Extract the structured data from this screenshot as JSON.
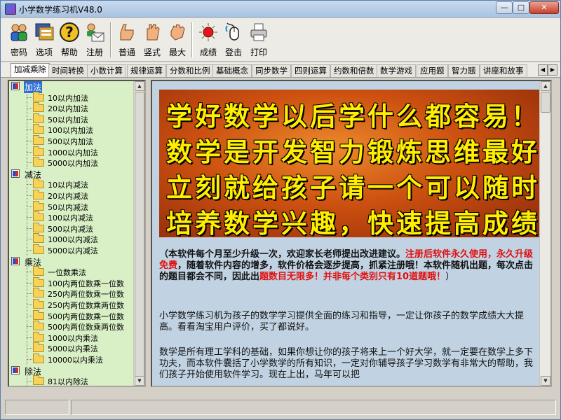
{
  "window": {
    "title": "小学数学练习机V48.0",
    "controls": {
      "minimize": "—",
      "maximize": "□",
      "close": "✕"
    }
  },
  "toolbar": {
    "buttons": [
      {
        "label": "密码",
        "icon": "users-icon"
      },
      {
        "label": "选项",
        "icon": "options-icon"
      },
      {
        "label": "帮助",
        "icon": "help-icon"
      },
      {
        "label": "注册",
        "icon": "register-icon"
      },
      {
        "label": "普通",
        "icon": "hand-normal-icon"
      },
      {
        "label": "竖式",
        "icon": "hand-vertical-icon"
      },
      {
        "label": "最大",
        "icon": "hand-max-icon"
      },
      {
        "label": "成绩",
        "icon": "score-icon"
      },
      {
        "label": "登击",
        "icon": "mouse-icon"
      },
      {
        "label": "打印",
        "icon": "printer-icon"
      }
    ]
  },
  "tabs": [
    "加减乘除",
    "时间转换",
    "小数计算",
    "规律运算",
    "分数和比例",
    "基础概念",
    "同步数学",
    "四则运算",
    "约数和倍数",
    "数学游戏",
    "应用题",
    "智力题",
    "讲座和故事"
  ],
  "tree": {
    "categories": [
      {
        "label": "加法",
        "selected": true,
        "items": [
          "10以内加法",
          "20以内加法",
          "50以内加法",
          "100以内加法",
          "500以内加法",
          "1000以内加法",
          "5000以内加法"
        ]
      },
      {
        "label": "减法",
        "selected": false,
        "items": [
          "10以内减法",
          "20以内减法",
          "50以内减法",
          "100以内减法",
          "500以内减法",
          "1000以内减法",
          "5000以内减法"
        ]
      },
      {
        "label": "乘法",
        "selected": false,
        "items": [
          "一位数乘法",
          "100内两位数乘一位数",
          "250内两位数乘一位数",
          "250内两位数乘两位数",
          "500内两位数乘一位数",
          "500内两位数乘两位数",
          "1000以内乘法",
          "5000以内乘法",
          "10000以内乘法"
        ]
      },
      {
        "label": "除法",
        "selected": false,
        "items": [
          "81以内除法"
        ]
      }
    ]
  },
  "content": {
    "banner_lines": [
      "学好数学以后学什么都容易！千万要",
      "数学是开发智力锻炼思维最好工具未",
      "立刻就给孩子请一个可以随时使用的",
      "培养数学兴趣，快速提高成绩，家长"
    ],
    "p1": {
      "a": "（本软件每个月至少升级一次，欢迎家长老师提出改进建议。",
      "b": "注册后软件永久使用，永久升级免费",
      "c": "，随着软件内容的增多，软件价格会逐步提高，抓紧注册哦！本软件随机出题，每次点击的题目都会不同，因此出",
      "d": "题数目无限多！并非每个类别只有10道题哦！",
      "e": "）"
    },
    "p2": "小学数学练习机为孩子的数学学习提供全面的练习和指导，一定让你孩子的数学成绩大大提高。看看淘宝用户评价，买了都说好。",
    "p3": "数学是所有理工学科的基础，如果你想让你的孩子将来上一个好大学，就一定要在数学上多下功夫，而本软件囊括了小学数学的所有知识，一定对你辅导孩子学习数学有非常大的帮助，我们孩子开始使用软件学习。现在上出，马年可以把"
  }
}
